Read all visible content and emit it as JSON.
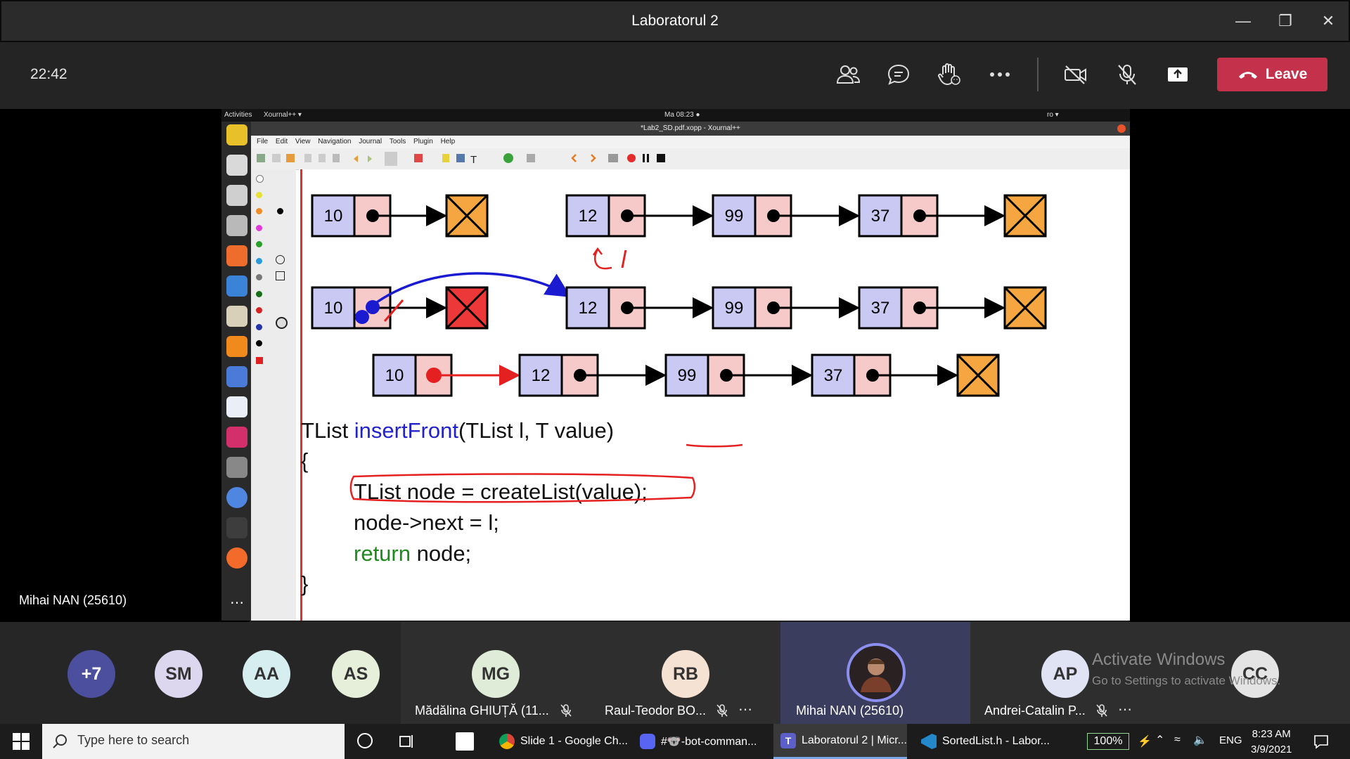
{
  "window": {
    "title": "Laboratorul 2"
  },
  "meeting": {
    "time": "22:42",
    "leave_label": "Leave",
    "presenter_name": "Mihai NAN (25610)",
    "controls": [
      "people-icon",
      "chat-icon",
      "raise-hand-icon",
      "more-icon",
      "camera-off-icon",
      "mic-off-icon",
      "share-icon"
    ]
  },
  "shared_screen": {
    "topbar_left": "Activities",
    "topbar_app": "Xournal++ ▾",
    "topbar_clock": "Ma 08:23 ●",
    "topbar_lang": "ro ▾",
    "doc_title": "*Lab2_SD.pdf.xopp - Xournal++",
    "menu": [
      "File",
      "Edit",
      "View",
      "Navigation",
      "Journal",
      "Tools",
      "Plugin",
      "Help"
    ],
    "list_row1_a": {
      "head": "10"
    },
    "list_row1_b": {
      "nodes": [
        "12",
        "99",
        "37"
      ]
    },
    "list_row2_a": {
      "head": "10"
    },
    "list_row2_b": {
      "nodes": [
        "12",
        "99",
        "37"
      ]
    },
    "list_row3": {
      "nodes": [
        "10",
        "12",
        "99",
        "37"
      ]
    },
    "annotation_label": "l",
    "code": {
      "line1_type": "TList ",
      "line1_fn": "insertFront",
      "line1_args": "(TList l, T value)",
      "line2": "{",
      "line3": "TList node = createList(value);",
      "line4": "node->next = l;",
      "line5_kw": "return",
      "line5_rest": " node;",
      "line6": "}"
    }
  },
  "participants": [
    {
      "initials": "+7",
      "color": "#4b4f9e"
    },
    {
      "initials": "SM",
      "color": "#dcd6ee"
    },
    {
      "initials": "AA",
      "color": "#d6eef0"
    },
    {
      "initials": "AS",
      "color": "#e6efd9"
    },
    {
      "initials": "MG",
      "name": "Mădălina GHIUȚĂ (11...",
      "color": "#dfecd8"
    },
    {
      "initials": "RB",
      "name": "Raul-Teodor BO...",
      "color": "#f6e2d2"
    },
    {
      "initials": "",
      "name": "Mihai NAN (25610)",
      "color": "#6a6fc4"
    },
    {
      "initials": "AP",
      "name": "Andrei-Catalin P...",
      "color": "#dfe3f3"
    },
    {
      "initials": "CC",
      "color": "#e4e4e4"
    }
  ],
  "watermark": {
    "line1": "Activate Windows",
    "line2": "Go to Settings to activate Windows."
  },
  "taskbar": {
    "search_placeholder": "Type here to search",
    "apps": [
      {
        "label": "Slide 1 - Google Ch...",
        "icon": "chrome-icon"
      },
      {
        "label": "#🐨-bot-comman...",
        "icon": "discord-icon"
      },
      {
        "label": "Laboratorul 2 | Micr...",
        "icon": "teams-icon"
      },
      {
        "label": "SortedList.h - Labor...",
        "icon": "vscode-icon"
      }
    ],
    "battery": "100%",
    "lang": "ENG",
    "time": "8:23 AM",
    "date": "3/9/2021"
  }
}
